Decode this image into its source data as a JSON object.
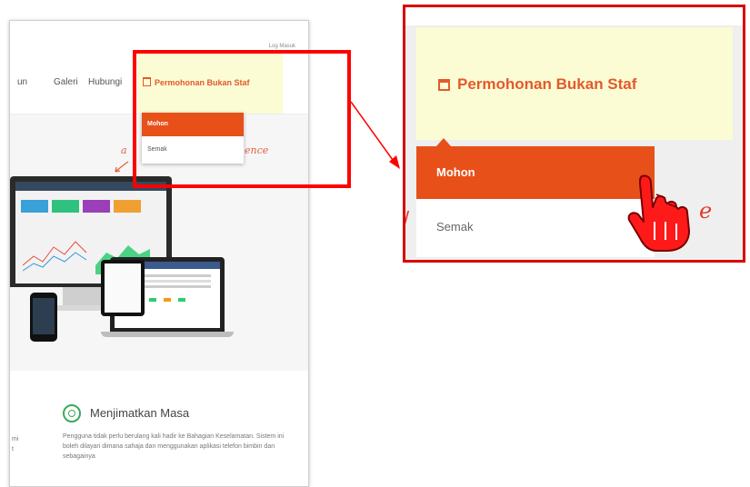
{
  "site": {
    "login_link": "Log Masuk",
    "nav": {
      "item_partial": "un",
      "galeri": "Galeri",
      "hubungi": "Hubungi",
      "permohonan": "Permohonan Bukan Staf",
      "calendar_icon": "calendar-icon"
    },
    "dropdown": {
      "items": [
        "Mohon",
        "Semak"
      ],
      "active": "Mohon"
    },
    "hero": {
      "handwritten_left": "a",
      "handwritten_right": "ence"
    },
    "feature": {
      "icon": "clock-circle-icon",
      "title": "Menjimatkan Masa",
      "description": "Pengguna tidak perlu berulang kali hadir ke Bahagian Keselamatan. Sistem ini boleh dilayari dimana sahaja dan menggunakan aplikasi telefon bimbin dan sebagainya",
      "left_fragment_1": "mi",
      "left_fragment_2": "t"
    }
  },
  "zoom": {
    "permohonan": "Permohonan Bukan Staf",
    "mohon": "Mohon",
    "semak": "Semak",
    "handwritten": "e",
    "cursor_icon": "hand-pointer-icon"
  },
  "colors": {
    "accent_orange": "#e8501a",
    "highlight_yellow": "#fcfcd4",
    "annotation_red": "#ff0000",
    "feature_green": "#3aaa5a"
  }
}
